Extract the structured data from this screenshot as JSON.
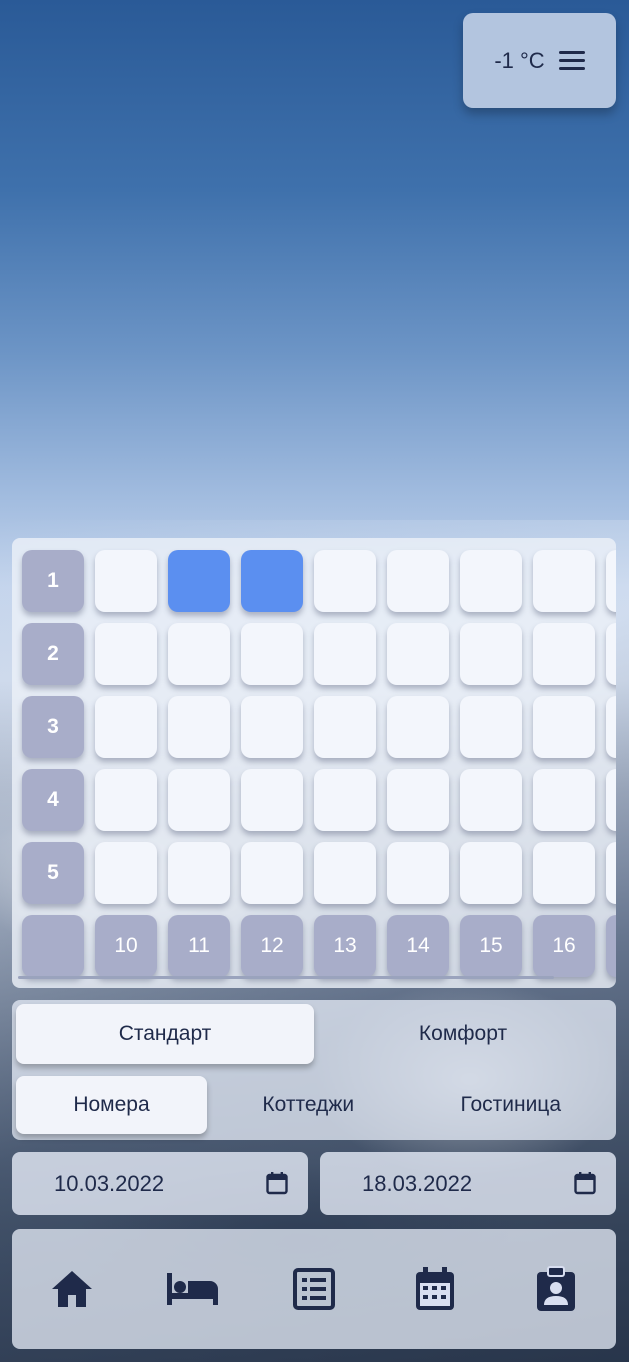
{
  "weather": {
    "temperature": "-1 °C"
  },
  "grid": {
    "rows": [
      "1",
      "2",
      "3",
      "4",
      "5"
    ],
    "days": [
      "10",
      "11",
      "12",
      "13",
      "14",
      "15",
      "16"
    ],
    "selected": [
      [
        0,
        1
      ],
      [
        0,
        2
      ]
    ]
  },
  "tabs": {
    "category": [
      "Стандарт",
      "Комфорт"
    ],
    "category_active": 0,
    "type": [
      "Номера",
      "Коттеджи",
      "Гостиница"
    ],
    "type_active": 0
  },
  "dates": {
    "from": "10.03.2022",
    "to": "18.03.2022"
  },
  "nav": {
    "icons": [
      "home-icon",
      "bed-icon",
      "list-icon",
      "calendar-icon",
      "badge-icon"
    ]
  },
  "colors": {
    "accent": "#5b8ff0",
    "text": "#1f2a4a",
    "header_cell": "#a8adc9"
  }
}
